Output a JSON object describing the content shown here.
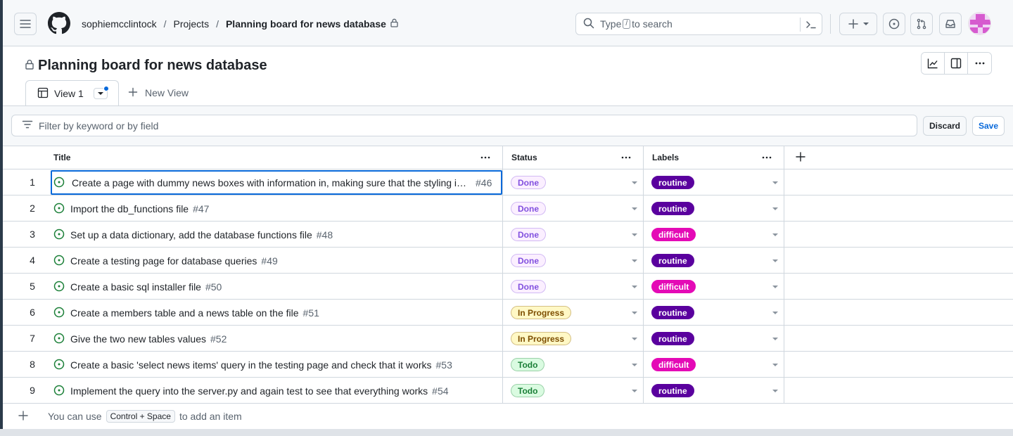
{
  "header": {
    "owner": "sophiemcclintock",
    "projects": "Projects",
    "project_name": "Planning board for news database",
    "search_prefix": "Type",
    "search_key": "/",
    "search_suffix": "to search"
  },
  "project": {
    "title": "Planning board for news database"
  },
  "tabs": {
    "active_label": "View 1",
    "new_view_label": "New View"
  },
  "filter": {
    "placeholder": "Filter by keyword or by field",
    "discard_label": "Discard",
    "save_label": "Save"
  },
  "columns": {
    "title": "Title",
    "status": "Status",
    "labels": "Labels"
  },
  "rows": [
    {
      "num": "1",
      "title": "Create a page with dummy news boxes with information in, making sure that the styling is consistent",
      "issue": "#46",
      "status": "Done",
      "label": "routine"
    },
    {
      "num": "2",
      "title": "Import the db_functions file",
      "issue": "#47",
      "status": "Done",
      "label": "routine"
    },
    {
      "num": "3",
      "title": "Set up a data dictionary, add the database functions file",
      "issue": "#48",
      "status": "Done",
      "label": "difficult"
    },
    {
      "num": "4",
      "title": "Create a testing page for database queries",
      "issue": "#49",
      "status": "Done",
      "label": "routine"
    },
    {
      "num": "5",
      "title": "Create a basic sql installer file",
      "issue": "#50",
      "status": "Done",
      "label": "difficult"
    },
    {
      "num": "6",
      "title": "Create a members table and a news table on the file",
      "issue": "#51",
      "status": "In Progress",
      "label": "routine"
    },
    {
      "num": "7",
      "title": "Give the two new tables values",
      "issue": "#52",
      "status": "In Progress",
      "label": "routine"
    },
    {
      "num": "8",
      "title": "Create a basic 'select news items' query in the testing page and check that it works",
      "issue": "#53",
      "status": "Todo",
      "label": "difficult"
    },
    {
      "num": "9",
      "title": "Implement the query into the server.py and again test to see that everything works",
      "issue": "#54",
      "status": "Todo",
      "label": "routine"
    }
  ],
  "add_item": {
    "prefix": "You can use",
    "shortcut": "Control + Space",
    "suffix": "to add an item"
  },
  "colors": {
    "done_fg": "#8250df",
    "done_bg": "#fbefff",
    "in_progress_fg": "#7d4e00",
    "in_progress_bg": "#fff8c5",
    "todo_fg": "#1a7f37",
    "todo_bg": "#dafbe1",
    "routine_bg": "#5a009e",
    "difficult_bg": "#e40ab6",
    "open_issue": "#1a7f37",
    "accent": "#0969da"
  },
  "icons": {
    "menu": "hamburger-icon",
    "logo": "github-logo-icon",
    "lock": "lock-icon",
    "search": "search-icon",
    "command": "command-palette-icon",
    "plus": "plus-icon",
    "issues": "issue-icon",
    "pulls": "pull-request-icon",
    "inbox": "inbox-icon",
    "avatar": "avatar-icon",
    "insights": "graph-icon",
    "sidebar": "sidebar-icon",
    "more": "kebab-horizontal-icon",
    "table": "table-icon",
    "filter": "filter-icon",
    "open": "issue-opened-icon"
  }
}
